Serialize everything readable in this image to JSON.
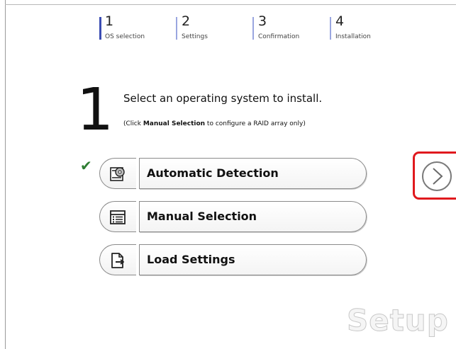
{
  "stepper": {
    "steps": [
      {
        "number": "1",
        "label": "OS selection",
        "state": "active"
      },
      {
        "number": "2",
        "label": "Settings",
        "state": "inactive"
      },
      {
        "number": "3",
        "label": "Confirmation",
        "state": "inactive"
      },
      {
        "number": "4",
        "label": "Installation",
        "state": "inactive"
      }
    ]
  },
  "main": {
    "step_number": "1",
    "heading": "Select an operating system to install.",
    "note_prefix": "(Click ",
    "note_bold": "Manual Selection",
    "note_suffix": " to configure a RAID array only)"
  },
  "options": [
    {
      "label": "Automatic Detection",
      "icon": "disc-drive-icon",
      "selected": true
    },
    {
      "label": "Manual Selection",
      "icon": "list-icon",
      "selected": false
    },
    {
      "label": "Load Settings",
      "icon": "load-file-icon",
      "selected": false
    }
  ],
  "next_button": {
    "icon": "chevron-right-icon",
    "highlighted": true
  },
  "watermark": "Setup",
  "colors": {
    "accent": "#3b4db3",
    "check": "#2e7d32",
    "highlight": "#e0191e"
  }
}
